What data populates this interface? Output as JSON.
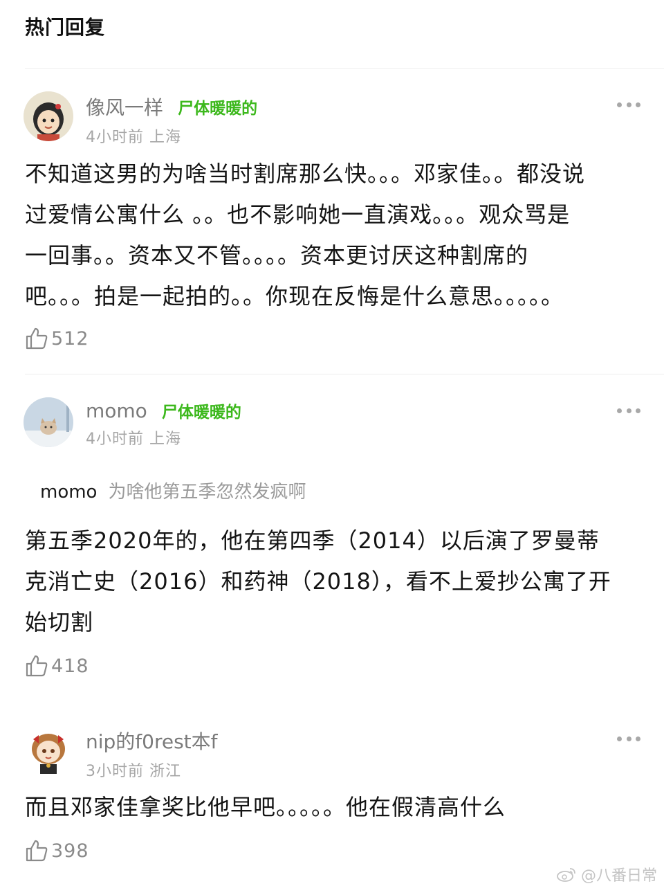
{
  "header": {
    "title": "热门回复"
  },
  "comments": [
    {
      "username": "像风一样",
      "badge": "尸体暖暖的",
      "time": "4小时前",
      "location": "上海",
      "text": "不知道这男的为啥当时割席那么快。。。邓家佳。。都没说\n过爱情公寓什么 。。也不影响她一直演戏。。。观众骂是\n一回事。。资本又不管。。。。资本更讨厌这种割席的\n吧。。。拍是一起拍的。。你现在反悔是什么意思。。。。。",
      "likes": "512",
      "avatar_icon": "cartoon-girl-avatar"
    },
    {
      "username": "momo",
      "badge": "尸体暖暖的",
      "time": "4小时前",
      "location": "上海",
      "quote_name": "momo",
      "quote_text": "为啥他第五季忽然发疯啊",
      "text": "第五季2020年的，他在第四季（2014）以后演了罗曼蒂\n克消亡史（2016）和药神（2018），看不上爱抄公寓了开\n始切割",
      "likes": "418",
      "avatar_icon": "cat-avatar"
    },
    {
      "username": "nip的f0rest本f",
      "badge": "",
      "time": "3小时前",
      "location": "浙江",
      "text": "而且邓家佳拿奖比他早吧。。。。。他在假清高什么",
      "likes": "398",
      "avatar_icon": "chibi-girl-avatar"
    }
  ],
  "watermark": {
    "text": "@八番日常",
    "icon": "weibo-icon"
  },
  "colors": {
    "badge": "#3cb81c",
    "meta": "#a6a6a6",
    "text": "#141414"
  }
}
